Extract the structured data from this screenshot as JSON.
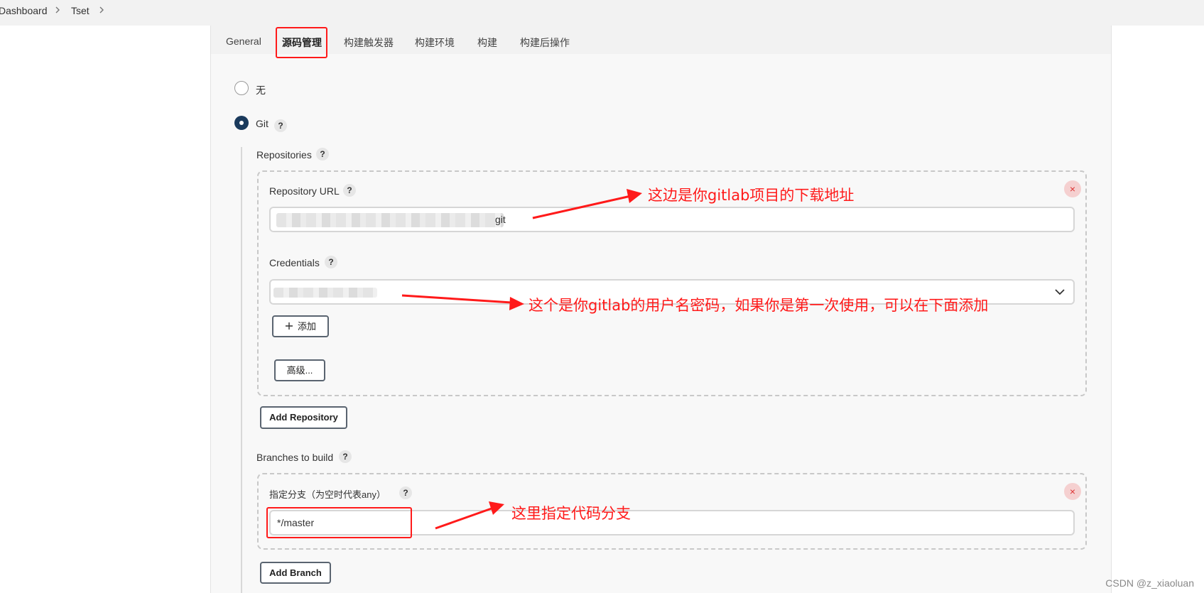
{
  "breadcrumb": {
    "items": [
      "Dashboard",
      "Tset"
    ]
  },
  "tabs": [
    {
      "label": "General",
      "active": false
    },
    {
      "label": "源码管理",
      "active": true
    },
    {
      "label": "构建触发器",
      "active": false
    },
    {
      "label": "构建环境",
      "active": false
    },
    {
      "label": "构建",
      "active": false
    },
    {
      "label": "构建后操作",
      "active": false
    }
  ],
  "scm": {
    "option_none": "无",
    "option_git": "Git",
    "selected": "Git",
    "help_glyph": "?"
  },
  "repositories": {
    "heading": "Repositories",
    "url_label": "Repository URL",
    "url_value_visible_suffix": "git",
    "credentials_label": "Credentials",
    "add_button": "添加",
    "advanced_button": "高级...",
    "add_repository_button": "Add Repository",
    "remove_glyph": "×"
  },
  "branches": {
    "heading": "Branches to build",
    "specifier_label": "指定分支（为空时代表any）",
    "specifier_value": "*/master",
    "add_branch_button": "Add Branch",
    "remove_glyph": "×"
  },
  "annotations": {
    "repo_url_note": "这边是你gitlab项目的下载地址",
    "credentials_note": "这个是你gitlab的用户名密码，如果你是第一次使用，可以在下面添加",
    "branch_note": "这里指定代码分支",
    "color": "#ff1a1a"
  },
  "icons": {
    "chevron_right": "chevron-right-icon",
    "chevron_down": "chevron-down-icon",
    "plus": "plus-icon",
    "remove": "close-icon",
    "help": "help-icon"
  },
  "watermark": "CSDN @z_xiaoluan"
}
